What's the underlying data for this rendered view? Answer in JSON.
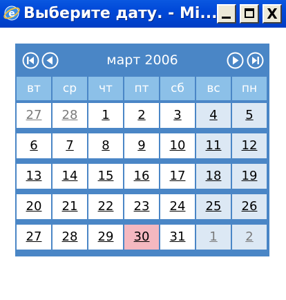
{
  "window": {
    "title": "Выберите дату. - Mi...",
    "minimize_label": "",
    "maximize_label": "",
    "close_label": "X"
  },
  "calendar": {
    "month_label": "март 2006",
    "weekdays": [
      "вт",
      "ср",
      "чт",
      "пт",
      "сб",
      "вс",
      "пн"
    ],
    "weeks": [
      [
        "27",
        "28",
        "1",
        "2",
        "3",
        "4",
        "5"
      ],
      [
        "6",
        "7",
        "8",
        "9",
        "10",
        "11",
        "12"
      ],
      [
        "13",
        "14",
        "15",
        "16",
        "17",
        "18",
        "19"
      ],
      [
        "20",
        "21",
        "22",
        "23",
        "24",
        "25",
        "26"
      ],
      [
        "27",
        "28",
        "29",
        "30",
        "31",
        "1",
        "2"
      ]
    ],
    "other_month_days": [
      [
        0,
        0
      ],
      [
        0,
        1
      ],
      [
        4,
        5
      ],
      [
        4,
        6
      ]
    ],
    "weekend_columns": [
      5,
      6
    ],
    "today": [
      4,
      3
    ],
    "colors": {
      "header": "#4a86c6",
      "weekday_header": "#8cc0e8",
      "weekend_cell": "#dce8f4",
      "today_cell": "#f4b8c0",
      "other_month_text": "#7a7a7a"
    },
    "nav_icons": [
      "first-month-icon",
      "prev-month-icon",
      "next-month-icon",
      "last-month-icon"
    ]
  }
}
